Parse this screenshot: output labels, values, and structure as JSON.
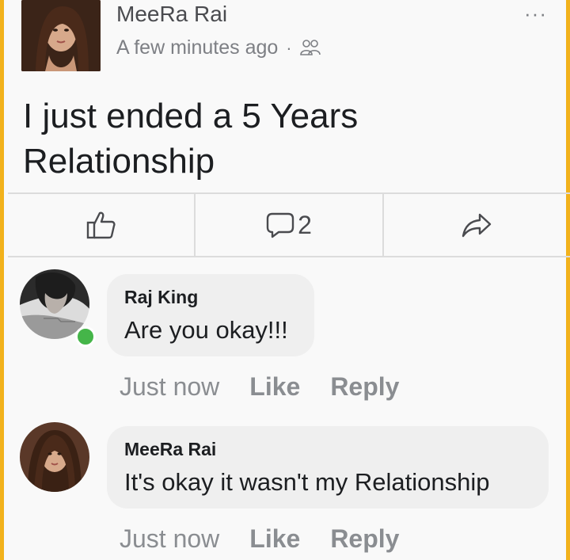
{
  "post": {
    "author": "MeeRa Rai",
    "time": "A few minutes ago",
    "separator": "·",
    "audience_icon": "friends-icon",
    "more_icon": "···",
    "text": "I just ended a 5 Years Relationship"
  },
  "actions": {
    "like_icon": "thumbs-up-icon",
    "comment_icon": "comment-icon",
    "comment_count": "2",
    "share_icon": "share-icon"
  },
  "comments": [
    {
      "author": "Raj King",
      "text": "Are you okay!!!",
      "time": "Just now",
      "like": "Like",
      "reply": "Reply",
      "online": true
    },
    {
      "author": "MeeRa Rai",
      "text": "It's okay it wasn't my Relationship",
      "time": "Just now",
      "like": "Like",
      "reply": "Reply",
      "online": false
    }
  ],
  "colors": {
    "frame_border": "#f2b21c",
    "online": "#45b549",
    "bubble": "#efefef"
  }
}
